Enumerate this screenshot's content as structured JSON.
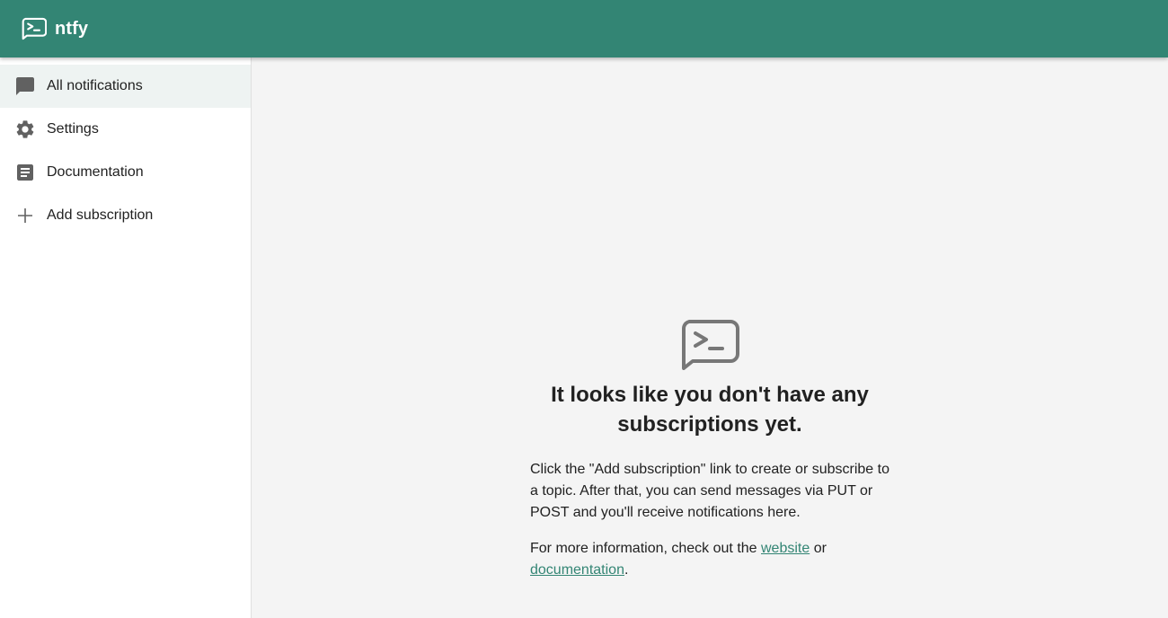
{
  "app": {
    "title": "ntfy",
    "brand_color": "#338574",
    "logo_icon": "terminal-message-icon"
  },
  "sidebar": {
    "items": [
      {
        "label": "All notifications",
        "icon": "chat-bubble-icon",
        "selected": true
      },
      {
        "label": "Settings",
        "icon": "gear-icon",
        "selected": false
      },
      {
        "label": "Documentation",
        "icon": "article-icon",
        "selected": false
      },
      {
        "label": "Add subscription",
        "icon": "plus-icon",
        "selected": false
      }
    ]
  },
  "main": {
    "empty_icon": "terminal-message-icon",
    "heading": "It looks like you don't have any subscriptions yet.",
    "paragraph1": "Click the \"Add subscription\" link to create or subscribe to a topic. After that, you can send messages via PUT or POST and you'll receive notifications here.",
    "paragraph2_prefix": "For more information, check out the ",
    "link_website": "website",
    "paragraph2_mid": " or ",
    "link_docs": "documentation",
    "paragraph2_suffix": "."
  }
}
